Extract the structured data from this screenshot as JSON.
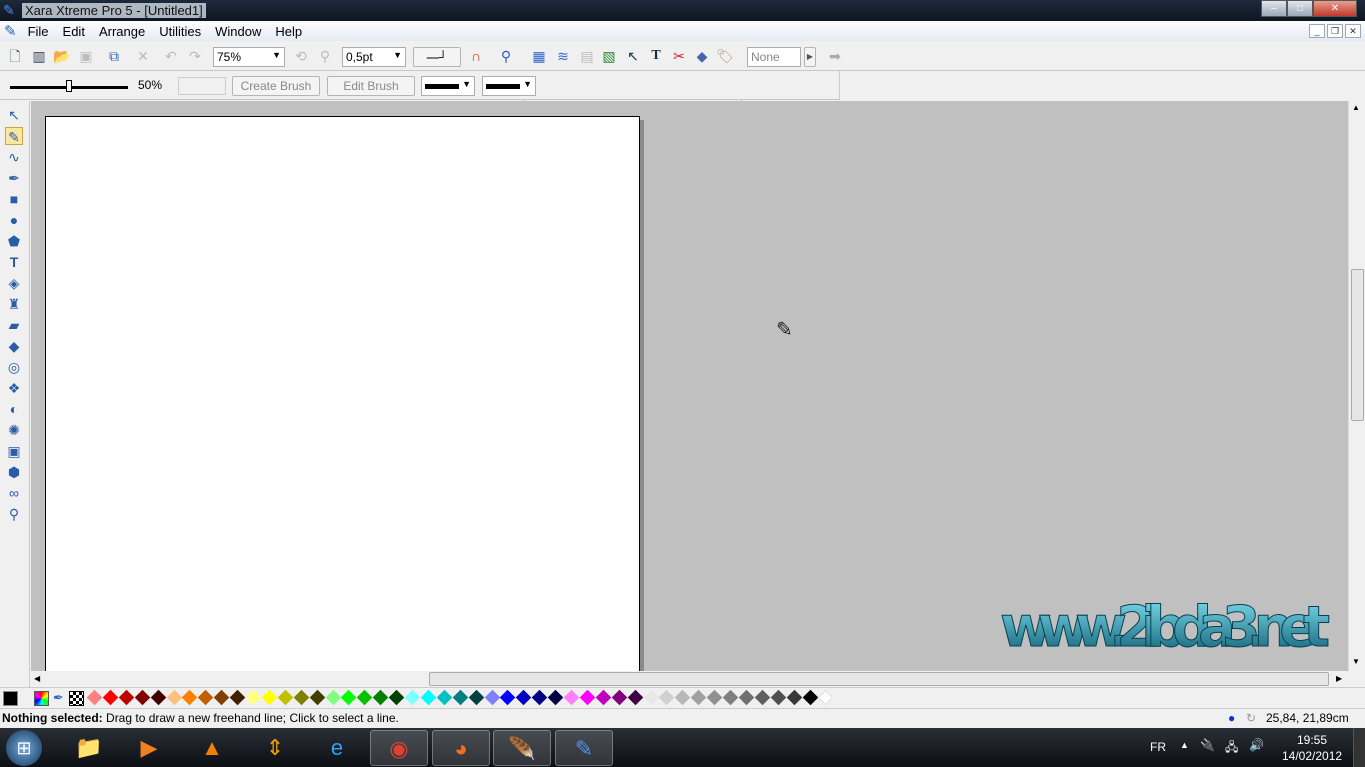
{
  "window": {
    "title": "Xara Xtreme Pro 5 - [Untitled1]",
    "minimize": "–",
    "maximize": "□",
    "close": "✕"
  },
  "menu": [
    "File",
    "Edit",
    "Arrange",
    "Utilities",
    "Window",
    "Help"
  ],
  "toolbar1": {
    "zoom_value": "75%",
    "line_width_value": "0,5pt",
    "name_value": "None",
    "icons": [
      "new-document-icon",
      "open-template-icon",
      "open-file-icon",
      "save-icon",
      "import-icon",
      "delete-icon",
      "undo-icon",
      "redo-icon"
    ]
  },
  "toolbar2": {
    "slider_value_percent": 50,
    "slider_label": "50%",
    "create_brush": "Create Brush",
    "edit_brush": "Edit Brush"
  },
  "tools": [
    "selector",
    "freehand",
    "bezier",
    "shape-editor",
    "rectangle",
    "ellipse",
    "quickshape",
    "text",
    "fill",
    "transparency",
    "mould",
    "bevel",
    "contour",
    "blend",
    "feather",
    "live-effects",
    "photo",
    "3d-extrude",
    "shadow",
    "zoom"
  ],
  "palette": {
    "colors": [
      "#ff8080",
      "#ff0000",
      "#c00000",
      "#800000",
      "#400000",
      "#ffc080",
      "#ff8000",
      "#c06000",
      "#804000",
      "#402000",
      "#ffff80",
      "#ffff00",
      "#c0c000",
      "#808000",
      "#404000",
      "#80ff80",
      "#00ff00",
      "#00c000",
      "#008000",
      "#004000",
      "#80ffff",
      "#00ffff",
      "#00c0c0",
      "#008080",
      "#004040",
      "#8080ff",
      "#0000ff",
      "#0000c0",
      "#000080",
      "#000040",
      "#ff80ff",
      "#ff00ff",
      "#c000c0",
      "#800080",
      "#400040",
      "#e8e8e8",
      "#d0d0d0",
      "#b8b8b8",
      "#a0a0a0",
      "#909090",
      "#808080",
      "#707070",
      "#606060",
      "#505050",
      "#383838",
      "#000000",
      "#ffffff"
    ],
    "current": "#000000"
  },
  "status": {
    "bold": "Nothing selected:",
    "text": " Drag to draw a new freehand line; Click to select a line.",
    "coords": "25,84, 21,89cm"
  },
  "watermark": "www.2ibda3.net",
  "taskbar": {
    "apps": [
      "explorer",
      "media-player",
      "vlc",
      "transfer",
      "internet-explorer",
      "chrome",
      "firefox",
      "feather-app",
      "xara"
    ],
    "lang": "FR",
    "time": "19:55",
    "date": "14/02/2012"
  }
}
